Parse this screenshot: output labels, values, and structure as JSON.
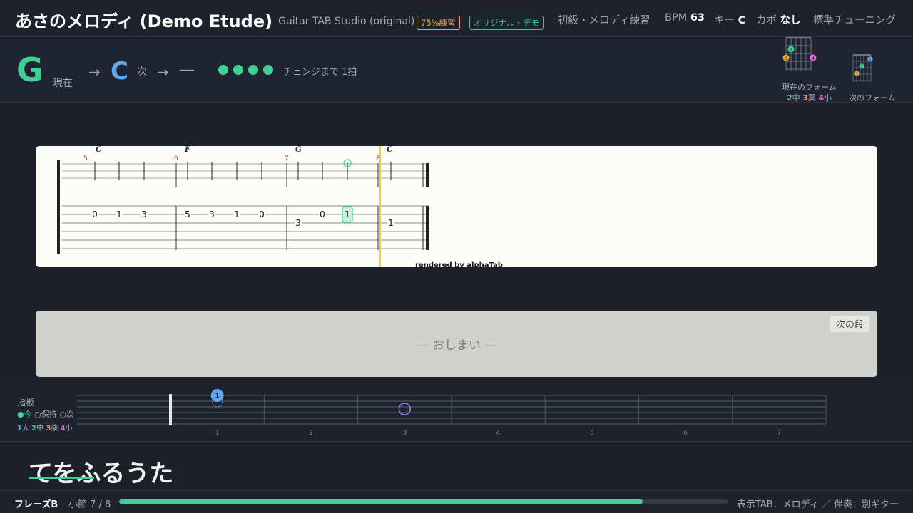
{
  "header": {
    "title": "あさのメロディ (Demo Etude)",
    "subtitle": "Guitar TAB Studio (original)",
    "badge_practice": "75%練習",
    "badge_demo": "オリジナル・デモ",
    "level": "初級・メロディ練習",
    "bpm_label": "BPM",
    "bpm_value": "63",
    "key_label": "キー",
    "key_value": "C",
    "capo_label": "カポ",
    "capo_value": "なし",
    "tuning": "標準チューニング"
  },
  "chords": {
    "current": "G",
    "current_label": "現在",
    "arrow": "→",
    "next": "C",
    "next_label": "次",
    "after": "—",
    "beats_remaining": 4,
    "change_text": "チェンジまで 1拍",
    "current_form_label": "現在のフォーム",
    "next_form_label": "次のフォーム",
    "fingering": [
      {
        "num": "2",
        "name": "中",
        "color": "#3fcf97"
      },
      {
        "num": "3",
        "name": "薬",
        "color": "#f2a93b"
      },
      {
        "num": "4",
        "name": "小",
        "color": "#e86ad7"
      }
    ]
  },
  "score": {
    "credit": "rendered by alphaTab",
    "measures": [
      {
        "number": "5",
        "chord": "C",
        "notes": [
          {
            "string": 2,
            "fret": "0"
          },
          {
            "string": 2,
            "fret": "1"
          },
          {
            "string": 2,
            "fret": "3"
          }
        ]
      },
      {
        "number": "6",
        "chord": "F",
        "notes": [
          {
            "string": 2,
            "fret": "5"
          },
          {
            "string": 2,
            "fret": "3"
          },
          {
            "string": 2,
            "fret": "1"
          },
          {
            "string": 2,
            "fret": "0"
          }
        ]
      },
      {
        "number": "7",
        "chord": "G",
        "notes": [
          {
            "string": 3,
            "fret": "3"
          },
          {
            "string": 2,
            "fret": "0"
          },
          {
            "string": 2,
            "fret": "1",
            "active": true
          }
        ]
      },
      {
        "number": "8",
        "chord": "C",
        "notes": [
          {
            "string": 3,
            "fret": "1"
          }
        ]
      }
    ]
  },
  "next_system": {
    "end_text": "— おしまい —",
    "button": "次の段"
  },
  "fretboard": {
    "title": "指板",
    "legend_now": "●今",
    "legend_hold": "○保持",
    "legend_next": "○次",
    "fingers": [
      {
        "num": "1",
        "name": "人",
        "color": "#62a7ee"
      },
      {
        "num": "2",
        "name": "中",
        "color": "#3fcf97"
      },
      {
        "num": "3",
        "name": "薬",
        "color": "#f2a93b"
      },
      {
        "num": "4",
        "name": "小",
        "color": "#e86ad7"
      }
    ],
    "fret_numbers": [
      "1",
      "2",
      "3",
      "4",
      "5",
      "6",
      "7"
    ],
    "current_marker": {
      "fret": 1,
      "finger": "1"
    },
    "next_marker": {
      "fret": 3
    }
  },
  "lyrics": {
    "text": "てをふるうた"
  },
  "footer": {
    "phrase": "フレーズB",
    "measure": "小節 7 / 8",
    "progress": 0.86,
    "note": "表示TAB：メロディ ／ 伴奏：別ギター"
  },
  "colors": {
    "accent_green": "#3fcf97",
    "accent_blue": "#62a7ee",
    "accent_orange": "#f2a93b",
    "accent_pink": "#e86ad7",
    "playhead": "#f5c84a"
  }
}
